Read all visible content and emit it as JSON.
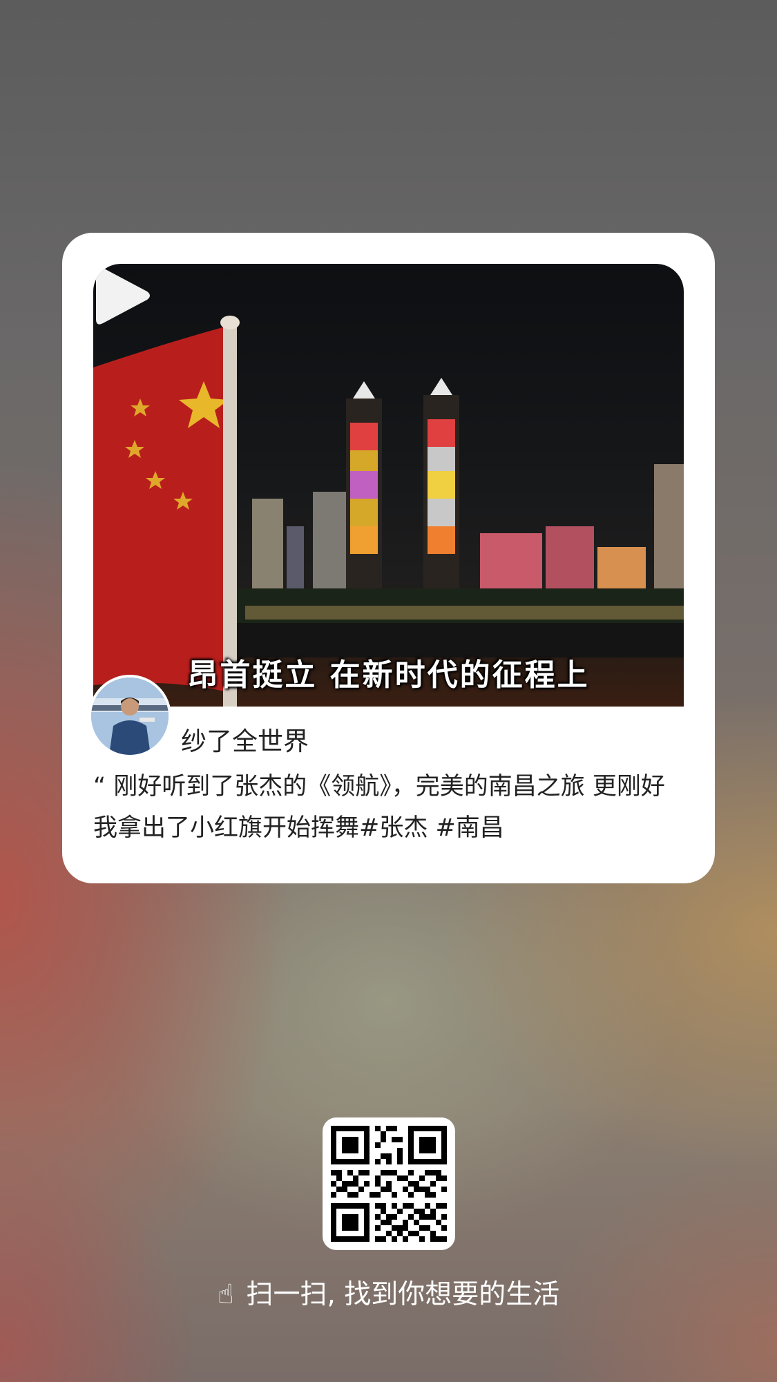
{
  "card": {
    "video": {
      "subtitle": "昂首挺立 在新时代的征程上",
      "thumbnail_description": "night city skyline with illuminated twin towers and national flag"
    },
    "author": {
      "name": "纱了全世界"
    },
    "description": "“ 刚好听到了张杰的《领航》，完美的南昌之旅 更刚好我拿出了小红旗开始挥舞#张杰  #南昌"
  },
  "footer": {
    "hand_icon": "☝",
    "scan_text": "扫一扫, 找到你想要的生活"
  },
  "colors": {
    "card_bg": "#ffffff",
    "text_primary": "#222222",
    "footer_text": "#ffffff"
  }
}
